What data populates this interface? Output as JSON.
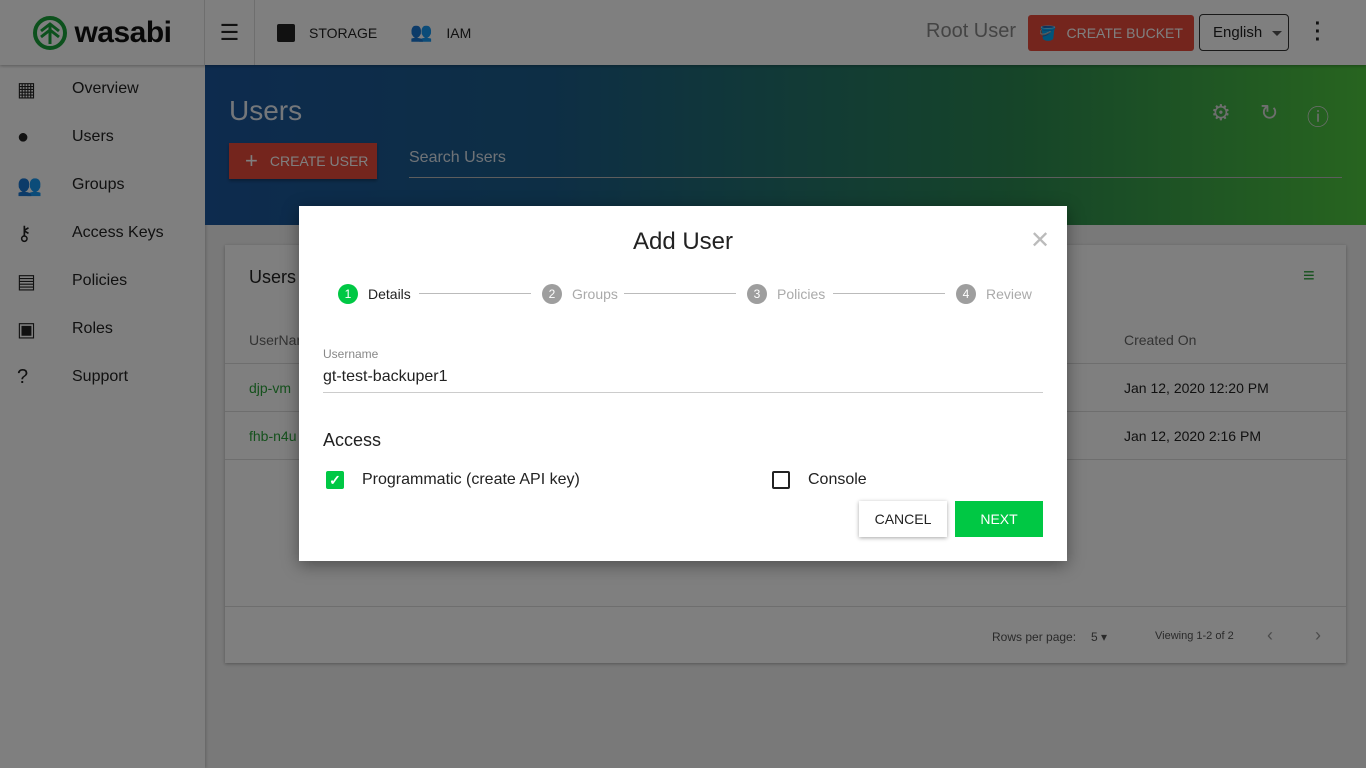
{
  "topbar": {
    "logo": "wasabi",
    "nav": [
      {
        "label": "STORAGE",
        "icon": "archive-icon"
      },
      {
        "label": "IAM",
        "icon": "people-icon"
      }
    ],
    "user": "Root User",
    "create_bucket": "CREATE BUCKET",
    "language": "English"
  },
  "sidebar": {
    "items": [
      {
        "label": "Overview",
        "icon": "dashboard-icon"
      },
      {
        "label": "Users",
        "icon": "person-icon"
      },
      {
        "label": "Groups",
        "icon": "group-icon"
      },
      {
        "label": "Access Keys",
        "icon": "key-icon"
      },
      {
        "label": "Policies",
        "icon": "library-icon"
      },
      {
        "label": "Roles",
        "icon": "badge-icon"
      },
      {
        "label": "Support",
        "icon": "help-icon"
      }
    ]
  },
  "hero": {
    "title": "Users",
    "create_user": "CREATE USER",
    "search_placeholder": "Search Users"
  },
  "card": {
    "title": "Users",
    "columns": [
      "UserName",
      "Created On"
    ],
    "rows": [
      {
        "name": "djp-vm",
        "created": "Jan 12, 2020 12:20 PM"
      },
      {
        "name": "fhb-n4u",
        "created": "Jan 12, 2020 2:16 PM"
      }
    ],
    "rows_per_page_label": "Rows per page:",
    "rows_per_page": "5",
    "viewing": "Viewing 1-2 of 2"
  },
  "dialog": {
    "title": "Add User",
    "steps": [
      {
        "n": "1",
        "label": "Details"
      },
      {
        "n": "2",
        "label": "Groups"
      },
      {
        "n": "3",
        "label": "Policies"
      },
      {
        "n": "4",
        "label": "Review"
      }
    ],
    "username_label": "Username",
    "username_value": "gt-test-backuper1",
    "access_label": "Access",
    "programmatic": "Programmatic (create API key)",
    "programmatic_checked": true,
    "console": "Console",
    "console_checked": false,
    "cancel": "CANCEL",
    "next": "NEXT"
  },
  "colors": {
    "accent_green": "#00c844",
    "brand_red": "#e84a3a"
  }
}
